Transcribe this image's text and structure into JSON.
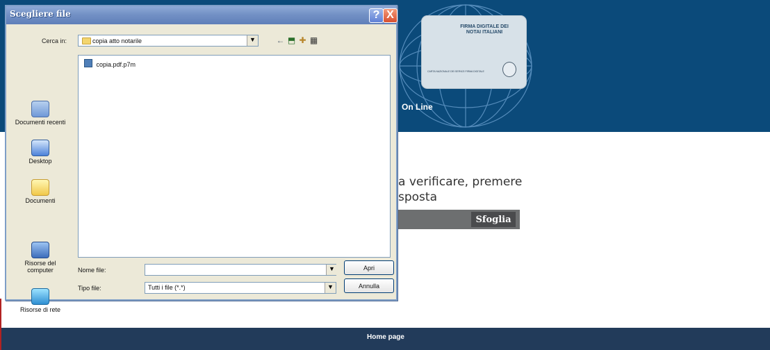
{
  "header": {
    "card_logo": "FIRMA DIGITALE DEI NOTAI ITALIANI",
    "card_text": "CARTA NAZIONALE DEI SERVIZI FIRMA DIGITALE",
    "title_fragment": "On Line"
  },
  "body": {
    "instruction_line_1": "a verificare, premere",
    "instruction_line_2": "sposta",
    "browse_label": "Sfoglia"
  },
  "footer": {
    "home_link": "Home page"
  },
  "dialog": {
    "title": "Scegliere file",
    "help_label": "?",
    "close_label": "X",
    "look_in_label": "Cerca in:",
    "look_in_value": "copia atto notarile",
    "back_icon": "←",
    "up_icon": "⬒",
    "new_folder_icon": "✚",
    "view_icon": "▦",
    "places": [
      {
        "label": "Documenti recenti",
        "icon": "recent-documents-icon"
      },
      {
        "label": "Desktop",
        "icon": "desktop-icon"
      },
      {
        "label": "Documenti",
        "icon": "documents-icon"
      },
      {
        "label": "Risorse del computer",
        "icon": "computer-icon"
      },
      {
        "label": "Risorse di rete",
        "icon": "network-icon"
      }
    ],
    "files": [
      {
        "name": "copia.pdf.p7m"
      }
    ],
    "file_name_label": "Nome file:",
    "file_name_value": "",
    "file_type_label": "Tipo file:",
    "file_type_value": "Tutti i file (*.*)",
    "open_label": "Apri",
    "cancel_label": "Annulla",
    "dropdown_arrow": "▼"
  }
}
